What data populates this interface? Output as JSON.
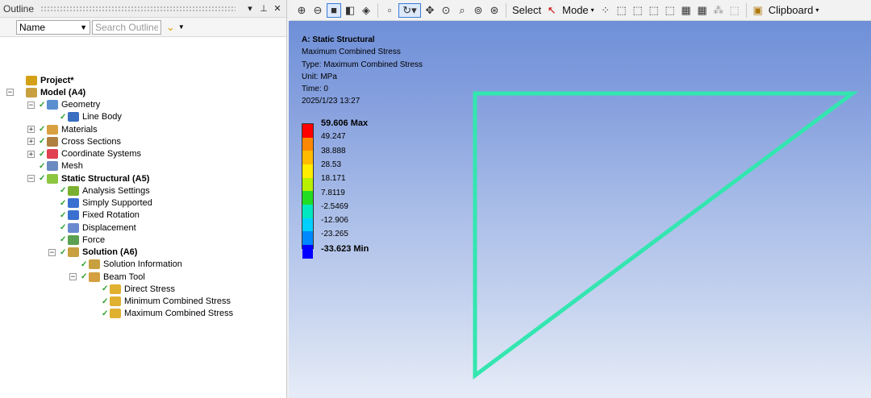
{
  "outline": {
    "title": "Outline",
    "header_buttons": {
      "dropdown": "▾",
      "pin": "⊥",
      "close": "✕"
    },
    "filter_select": "Name",
    "search_placeholder": "Search Outline"
  },
  "tree": [
    {
      "label": "Project*",
      "bold": true,
      "icon": "project-icon",
      "status": ""
    },
    {
      "label": "Model (A4)",
      "bold": true,
      "icon": "model-icon",
      "status": ""
    },
    {
      "label": "Geometry",
      "bold": false,
      "icon": "geometry-icon",
      "status": "✓"
    },
    {
      "label": "Line Body",
      "bold": false,
      "icon": "line-body-icon",
      "status": "✓"
    },
    {
      "label": "Materials",
      "bold": false,
      "icon": "materials-icon",
      "status": "✓"
    },
    {
      "label": "Cross Sections",
      "bold": false,
      "icon": "cross-sections-icon",
      "status": "✓"
    },
    {
      "label": "Coordinate Systems",
      "bold": false,
      "icon": "coordinate-systems-icon",
      "status": "✓"
    },
    {
      "label": "Mesh",
      "bold": false,
      "icon": "mesh-icon",
      "status": "✓"
    },
    {
      "label": "Static Structural (A5)",
      "bold": true,
      "icon": "static-structural-icon",
      "status": "✓"
    },
    {
      "label": "Analysis Settings",
      "bold": false,
      "icon": "analysis-settings-icon",
      "status": "✓"
    },
    {
      "label": "Simply Supported",
      "bold": false,
      "icon": "simply-supported-icon",
      "status": "✓"
    },
    {
      "label": "Fixed Rotation",
      "bold": false,
      "icon": "fixed-rotation-icon",
      "status": "✓"
    },
    {
      "label": "Displacement",
      "bold": false,
      "icon": "displacement-icon",
      "status": "✓"
    },
    {
      "label": "Force",
      "bold": false,
      "icon": "force-icon",
      "status": "✓"
    },
    {
      "label": "Solution (A6)",
      "bold": true,
      "icon": "solution-icon",
      "status": "✓"
    },
    {
      "label": "Solution Information",
      "bold": false,
      "icon": "solution-information-icon",
      "status": "✓"
    },
    {
      "label": "Beam Tool",
      "bold": false,
      "icon": "beam-tool-icon",
      "status": "✓"
    },
    {
      "label": "Direct Stress",
      "bold": false,
      "icon": "result-icon",
      "status": "✓"
    },
    {
      "label": "Minimum Combined Stress",
      "bold": false,
      "icon": "result-icon",
      "status": "✓"
    },
    {
      "label": "Maximum Combined Stress",
      "bold": false,
      "icon": "result-icon",
      "status": "✓"
    }
  ],
  "toolbar": {
    "select_label": "Select",
    "mode_label": "Mode",
    "clipboard_label": "Clipboard"
  },
  "viewport": {
    "info": {
      "title": "A: Static Structural",
      "result": "Maximum Combined Stress",
      "type": "Type: Maximum Combined Stress",
      "unit": "Unit: MPa",
      "time": "Time: 0",
      "date": "2025/1/23 13:27"
    },
    "legend": {
      "colors": [
        "#ff0000",
        "#ff8800",
        "#ffbb00",
        "#ffee00",
        "#b8f000",
        "#22dd22",
        "#00e8c0",
        "#00d0ff",
        "#0088ff",
        "#0000ff"
      ],
      "labels": [
        "59.606 Max",
        "49.247",
        "38.888",
        "28.53",
        "18.171",
        "7.8119",
        "-2.5469",
        "-12.906",
        "-23.265",
        "-33.623 Min"
      ]
    },
    "shape_color": "#33e6b0"
  }
}
